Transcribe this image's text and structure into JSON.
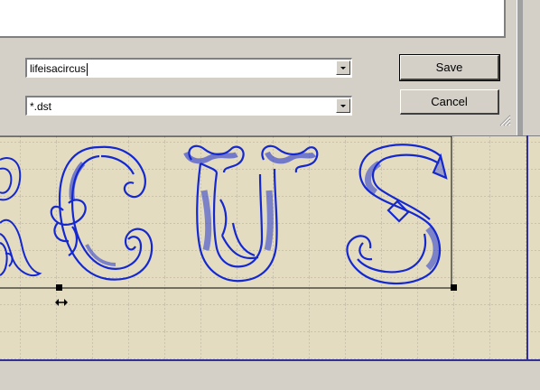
{
  "file_dialog": {
    "filename_value": "lifeisacircus",
    "filetype_value": "*.dst",
    "save_label": "Save",
    "cancel_label": "Cancel"
  },
  "design": {
    "visible_letters": [
      "R",
      "C",
      "U",
      "S"
    ],
    "stitch_color": "#1428d0"
  },
  "colors": {
    "dialog_bg": "#d4d0c8",
    "canvas_bg": "#e4dcc0",
    "grid": "#b0a898"
  },
  "icons": [
    "dropdown-arrow-icon",
    "resize-grip-icon",
    "horizontal-resize-cursor-icon",
    "selection-handle-icon"
  ]
}
